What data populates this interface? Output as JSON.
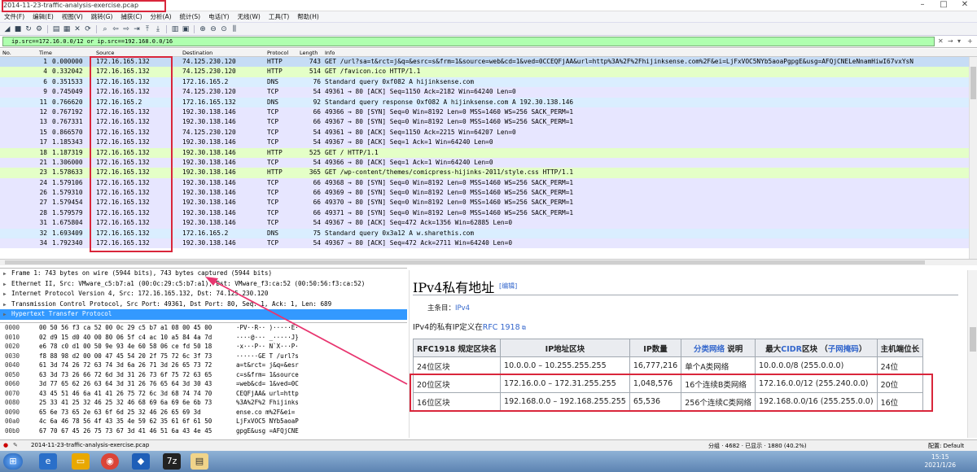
{
  "window": {
    "title": "2014-11-23-traffic-analysis-exercise.pcap"
  },
  "menu": [
    "文件(F)",
    "编辑(E)",
    "视图(V)",
    "跳转(G)",
    "捕获(C)",
    "分析(A)",
    "统计(S)",
    "电话(Y)",
    "无线(W)",
    "工具(T)",
    "帮助(H)"
  ],
  "filter": {
    "value": "ip.src==172.16.0.0/12 or ip.src==192.168.0.0/16"
  },
  "columns": {
    "no": "No.",
    "time": "Time",
    "source": "Source",
    "destination": "Destination",
    "protocol": "Protocol",
    "length": "Length",
    "info": "Info"
  },
  "packets": [
    {
      "no": "1",
      "time": "0.000000",
      "src": "172.16.165.132",
      "dst": "74.125.230.120",
      "proto": "HTTP",
      "len": "743",
      "info": "GET /url?sa=t&rct=j&q=&esrc=s&frm=1&source=web&cd=1&ved=0CCEQFjAA&url=http%3A%2F%2Fhijinksense.com%2F&ei=LjFxVOC5NYb5aoaPgpgE&usg=AFQjCNELeNnamHiwI67vxYsN"
    },
    {
      "no": "4",
      "time": "0.332042",
      "src": "172.16.165.132",
      "dst": "74.125.230.120",
      "proto": "HTTP",
      "len": "514",
      "info": "GET /favicon.ico HTTP/1.1"
    },
    {
      "no": "6",
      "time": "0.351533",
      "src": "172.16.165.132",
      "dst": "172.16.165.2",
      "proto": "DNS",
      "len": "76",
      "info": "Standard query 0xf082 A hijinksense.com"
    },
    {
      "no": "9",
      "time": "0.745049",
      "src": "172.16.165.132",
      "dst": "74.125.230.120",
      "proto": "TCP",
      "len": "54",
      "info": "49361 → 80 [ACK] Seq=1150 Ack=2182 Win=64240 Len=0"
    },
    {
      "no": "11",
      "time": "0.766620",
      "src": "172.16.165.2",
      "dst": "172.16.165.132",
      "proto": "DNS",
      "len": "92",
      "info": "Standard query response 0xf082 A hijinksense.com A 192.30.138.146"
    },
    {
      "no": "12",
      "time": "0.767192",
      "src": "172.16.165.132",
      "dst": "192.30.138.146",
      "proto": "TCP",
      "len": "66",
      "info": "49366 → 80 [SYN] Seq=0 Win=8192 Len=0 MSS=1460 WS=256 SACK_PERM=1"
    },
    {
      "no": "13",
      "time": "0.767331",
      "src": "172.16.165.132",
      "dst": "192.30.138.146",
      "proto": "TCP",
      "len": "66",
      "info": "49367 → 80 [SYN] Seq=0 Win=8192 Len=0 MSS=1460 WS=256 SACK_PERM=1"
    },
    {
      "no": "15",
      "time": "0.866570",
      "src": "172.16.165.132",
      "dst": "74.125.230.120",
      "proto": "TCP",
      "len": "54",
      "info": "49361 → 80 [ACK] Seq=1150 Ack=2215 Win=64207 Len=0"
    },
    {
      "no": "17",
      "time": "1.185343",
      "src": "172.16.165.132",
      "dst": "192.30.138.146",
      "proto": "TCP",
      "len": "54",
      "info": "49367 → 80 [ACK] Seq=1 Ack=1 Win=64240 Len=0"
    },
    {
      "no": "18",
      "time": "1.187319",
      "src": "172.16.165.132",
      "dst": "192.30.138.146",
      "proto": "HTTP",
      "len": "525",
      "info": "GET / HTTP/1.1"
    },
    {
      "no": "21",
      "time": "1.306000",
      "src": "172.16.165.132",
      "dst": "192.30.138.146",
      "proto": "TCP",
      "len": "54",
      "info": "49366 → 80 [ACK] Seq=1 Ack=1 Win=64240 Len=0"
    },
    {
      "no": "23",
      "time": "1.578633",
      "src": "172.16.165.132",
      "dst": "192.30.138.146",
      "proto": "HTTP",
      "len": "365",
      "info": "GET /wp-content/themes/comicpress-hijinks-2011/style.css HTTP/1.1"
    },
    {
      "no": "24",
      "time": "1.579106",
      "src": "172.16.165.132",
      "dst": "192.30.138.146",
      "proto": "TCP",
      "len": "66",
      "info": "49368 → 80 [SYN] Seq=0 Win=8192 Len=0 MSS=1460 WS=256 SACK_PERM=1"
    },
    {
      "no": "26",
      "time": "1.579310",
      "src": "172.16.165.132",
      "dst": "192.30.138.146",
      "proto": "TCP",
      "len": "66",
      "info": "49369 → 80 [SYN] Seq=0 Win=8192 Len=0 MSS=1460 WS=256 SACK_PERM=1"
    },
    {
      "no": "27",
      "time": "1.579454",
      "src": "172.16.165.132",
      "dst": "192.30.138.146",
      "proto": "TCP",
      "len": "66",
      "info": "49370 → 80 [SYN] Seq=0 Win=8192 Len=0 MSS=1460 WS=256 SACK_PERM=1"
    },
    {
      "no": "28",
      "time": "1.579579",
      "src": "172.16.165.132",
      "dst": "192.30.138.146",
      "proto": "TCP",
      "len": "66",
      "info": "49371 → 80 [SYN] Seq=0 Win=8192 Len=0 MSS=1460 WS=256 SACK_PERM=1"
    },
    {
      "no": "31",
      "time": "1.675804",
      "src": "172.16.165.132",
      "dst": "192.30.138.146",
      "proto": "TCP",
      "len": "54",
      "info": "49367 → 80 [ACK] Seq=472 Ack=1356 Win=62885 Len=0"
    },
    {
      "no": "32",
      "time": "1.693409",
      "src": "172.16.165.132",
      "dst": "172.16.165.2",
      "proto": "DNS",
      "len": "75",
      "info": "Standard query 0x3a12 A w.sharethis.com"
    },
    {
      "no": "34",
      "time": "1.792340",
      "src": "172.16.165.132",
      "dst": "192.30.138.146",
      "proto": "TCP",
      "len": "54",
      "info": "49367 → 80 [ACK] Seq=472 Ack=2711 Win=64240 Len=0"
    }
  ],
  "details": [
    "Frame 1: 743 bytes on wire (5944 bits), 743 bytes captured (5944 bits)",
    "Ethernet II, Src: VMware_c5:b7:a1 (00:0c:29:c5:b7:a1), Dst: VMware_f3:ca:52 (00:50:56:f3:ca:52)",
    "Internet Protocol Version 4, Src: 172.16.165.132, Dst: 74.125.230.120",
    "Transmission Control Protocol, Src Port: 49361, Dst Port: 80, Seq: 1, Ack: 1, Len: 689",
    "Hypertext Transfer Protocol"
  ],
  "bytes": [
    {
      "off": "0000",
      "hex": "00 50 56 f3 ca 52 00 0c  29 c5 b7 a1 08 00 45 00",
      "asc": "·PV··R·· )·····E·"
    },
    {
      "off": "0010",
      "hex": "02 d9 15 d0 40 00 80 06  5f c4 ac 10 a5 84 4a 7d",
      "asc": "····@··· _·····J}"
    },
    {
      "off": "0020",
      "hex": "e6 78 c0 d1 00 50 9e 93  4e 60 58 06 ce fd 50 18",
      "asc": "·x···P·· N`X···P·"
    },
    {
      "off": "0030",
      "hex": "f8 88 98 d2 00 00 47 45  54 20 2f 75 72 6c 3f 73",
      "asc": "······GE T /url?s"
    },
    {
      "off": "0040",
      "hex": "61 3d 74 26 72 63 74 3d  6a 26 71 3d 26 65 73 72",
      "asc": "a=t&rct= j&q=&esr"
    },
    {
      "off": "0050",
      "hex": "63 3d 73 26 66 72 6d 3d  31 26 73 6f 75 72 63 65",
      "asc": "c=s&frm= 1&source"
    },
    {
      "off": "0060",
      "hex": "3d 77 65 62 26 63 64 3d  31 26 76 65 64 3d 30 43",
      "asc": "=web&cd= 1&ved=0C"
    },
    {
      "off": "0070",
      "hex": "43 45 51 46 6a 41 41 26  75 72 6c 3d 68 74 74 70",
      "asc": "CEQFjAA& url=http"
    },
    {
      "off": "0080",
      "hex": "25 33 41 25 32 46 25 32  46 68 69 6a 69 6e 6b 73",
      "asc": "%3A%2F%2 Fhijinks"
    },
    {
      "off": "0090",
      "hex": "65 6e 73 65 2e 63 6f 6d  25 32 46 26 65 69 3d",
      "asc": "ense.co m%2F&ei="
    },
    {
      "off": "00a0",
      "hex": "4c 6a 46 78 56 4f 43 35  4e 59 62 35 61 6f 61 50",
      "asc": "LjFxVOC5 NYb5aoaP"
    },
    {
      "off": "00b0",
      "hex": "67 70 67 45 26 75 73 67  3d 41 46 51 6a 43 4e 45",
      "asc": "gpgE&usg =AFQjCNE"
    }
  ],
  "status": {
    "file": "2014-11-23-traffic-analysis-exercise.pcap",
    "packets": "分组 · 4682 · 已显示 · 1880 (40.2%)",
    "profile": "配置: Default"
  },
  "wiki": {
    "title": "IPv4私有地址",
    "edit": "[编辑]",
    "main_prefix": "主条目：",
    "main_link": "IPv4",
    "intro_prefix": "IPv4的私有IP定义在",
    "intro_link": "RFC 1918",
    "headers": {
      "c1": "RFC1918 规定区块名",
      "c2": "IP地址区块",
      "c3": "IP数量",
      "c4_link": "分类网络",
      "c4_rest": " 说明",
      "c5_pre": "最大",
      "c5_link1": "CIDR",
      "c5_mid": "区块 （",
      "c5_link2": "子网掩码",
      "c5_post": "）",
      "c6": "主机端位长"
    },
    "rows": [
      {
        "name": "24位区块",
        "range": "10.0.0.0 – 10.255.255.255",
        "count": "16,777,216",
        "desc": "单个A类网络",
        "cidr": "10.0.0.0/8 (255.0.0.0)",
        "bits": "24位"
      },
      {
        "name": "20位区块",
        "range": "172.16.0.0 – 172.31.255.255",
        "count": "1,048,576",
        "desc": "16个连续B类网络",
        "cidr": "172.16.0.0/12 (255.240.0.0)",
        "bits": "20位"
      },
      {
        "name": "16位区块",
        "range": "192.168.0.0 – 192.168.255.255",
        "count": "65,536",
        "desc": "256个连续C类网络",
        "cidr": "192.168.0.0/16 (255.255.0.0)",
        "bits": "16位"
      }
    ]
  },
  "taskbar": {
    "time": "15:15",
    "date": "2021/1/26"
  },
  "colors": {
    "annotation": "#d9263b",
    "arrow": "#e8356f",
    "filter_ok": "#afffaf",
    "http_row": "#e4ffc7",
    "tcp_row": "#e7e6ff",
    "dns_row": "#daeeff"
  }
}
